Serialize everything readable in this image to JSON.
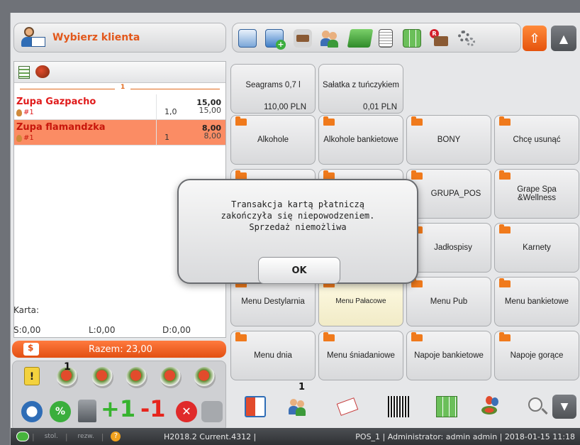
{
  "header": {
    "client_button_label": "Wybierz klienta"
  },
  "order": {
    "separator_number": "1",
    "items": [
      {
        "name": "Zupa Gazpacho",
        "seat": "#1",
        "qty": "1,0",
        "price": "15,00",
        "unit_price": "15,00",
        "selected": false
      },
      {
        "name": "Zupa flamandzka",
        "seat": "#1",
        "qty": "1",
        "price": "8,00",
        "unit_price": "8,00",
        "selected": true
      }
    ],
    "karta_label": "Karta:",
    "s_value": "S:0,00",
    "l_value": "L:0,00",
    "d_value": "D:0,00",
    "total_label": "Razem: 23,00",
    "func_badge": "1",
    "plus_one": "+1",
    "minus_one": "-1"
  },
  "products": [
    {
      "label": "Seagrams 0,7 l",
      "price": "110,00 PLN",
      "folder": false
    },
    {
      "label": "Sałatka z tuńczykiem",
      "price": "0,01 PLN",
      "folder": false
    },
    {
      "label": "Alkohole",
      "folder": true
    },
    {
      "label": "Alkohole bankietowe",
      "folder": true
    },
    {
      "label": "BONY",
      "folder": true
    },
    {
      "label": "Chcę usunąć",
      "folder": true
    },
    {
      "label": "GRUPA_POS",
      "folder": true
    },
    {
      "label": "Grape Spa &Wellness",
      "folder": true
    },
    {
      "label": "Jadłospisy",
      "folder": true
    },
    {
      "label": "Karnety",
      "folder": true
    },
    {
      "label": "Menu Destylarnia",
      "folder": true
    },
    {
      "label": "Menu Pałacowe",
      "folder": true
    },
    {
      "label": "Menu Pub",
      "folder": true
    },
    {
      "label": "Menu bankietowe",
      "folder": true
    },
    {
      "label": "Menu dnia",
      "folder": true
    },
    {
      "label": "Menu śniadaniowe",
      "folder": true
    },
    {
      "label": "Napoje bankietowe",
      "folder": true
    },
    {
      "label": "Napoje gorące",
      "folder": true
    }
  ],
  "bottom_toolbar": {
    "badge": "1"
  },
  "modal": {
    "line1": "Transakcja kartą płatniczą",
    "line2": "zakończyła się niepowodzeniem.",
    "line3": "Sprzedaż niemożliwa",
    "ok_label": "OK"
  },
  "statusbar": {
    "stol": "stol.",
    "rezw": "rezw.",
    "help": "?",
    "version": "H2018.2 Current.4312 |",
    "info": "POS_1 | Administrator: admin admin | 2018-01-15 11:18"
  },
  "colors": {
    "accent_orange": "#e2581c",
    "selected_row": "#fb8c64",
    "error_red": "#e01b1b",
    "status_green": "#47b33c"
  },
  "icons": [
    "client-avatar-icon",
    "client-card-icon",
    "add-client-icon",
    "table-icon",
    "users-icon",
    "cash-icon",
    "receipt-icon",
    "grid-edit-icon",
    "reservation-icon",
    "settings-gears-icon",
    "export-icon",
    "arrow-up-icon",
    "arrow-down-icon",
    "split-icon",
    "barcode-icon",
    "search-icon",
    "clock-icon",
    "percent-icon",
    "stamp-icon",
    "cancel-icon"
  ]
}
